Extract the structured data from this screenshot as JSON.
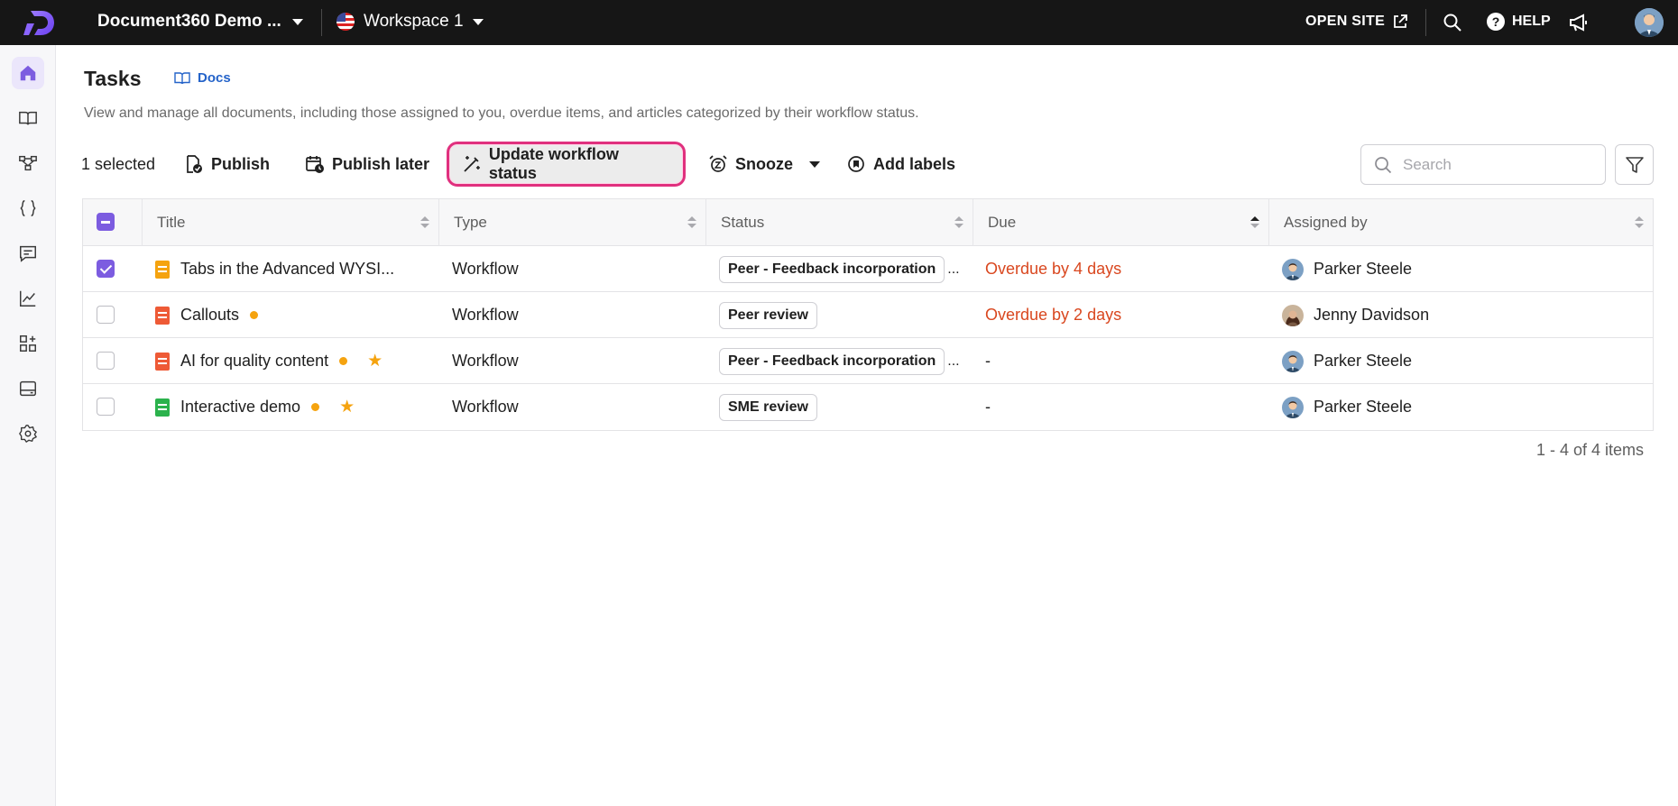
{
  "topbar": {
    "project_name": "Document360 Demo ...",
    "workspace": "Workspace 1",
    "open_site": "OPEN SITE",
    "help": "HELP",
    "help_glyph": "?"
  },
  "sidebar": {
    "items": [
      {
        "name": "home-icon",
        "active": true
      },
      {
        "name": "book-icon",
        "active": false
      },
      {
        "name": "workflow-icon",
        "active": false
      },
      {
        "name": "api-braces-icon",
        "active": false
      },
      {
        "name": "feedback-icon",
        "active": false
      },
      {
        "name": "analytics-icon",
        "active": false
      },
      {
        "name": "integrations-icon",
        "active": false
      },
      {
        "name": "widget-icon",
        "active": false
      },
      {
        "name": "settings-icon",
        "active": false
      }
    ]
  },
  "header": {
    "title": "Tasks",
    "docs_link": "Docs",
    "subtitle": "View and manage all documents, including those assigned to you, overdue items, and articles categorized by their workflow status."
  },
  "toolbar": {
    "selected_count": "1 selected",
    "publish": "Publish",
    "publish_later": "Publish later",
    "update_workflow": "Update workflow status",
    "snooze": "Snooze",
    "add_labels": "Add labels",
    "search_placeholder": "Search"
  },
  "table": {
    "headers": {
      "title": "Title",
      "type": "Type",
      "status": "Status",
      "due": "Due",
      "assigned_by": "Assigned by"
    },
    "rows": [
      {
        "title": "Tabs in the Advanced WYSI...",
        "doc_color": "#f5a30f",
        "dot": false,
        "star": false,
        "type": "Workflow",
        "status": "Peer - Feedback incorporation",
        "status_truncated": true,
        "due": "Overdue by 4 days",
        "overdue": true,
        "assigned_by": "Parker Steele",
        "checked": true
      },
      {
        "title": "Callouts",
        "doc_color": "#ee5a36",
        "dot": true,
        "star": false,
        "type": "Workflow",
        "status": "Peer review",
        "status_truncated": false,
        "due": "Overdue by 2 days",
        "overdue": true,
        "assigned_by": "Jenny Davidson",
        "checked": false
      },
      {
        "title": "AI for quality content",
        "doc_color": "#ee5a36",
        "dot": true,
        "star": true,
        "type": "Workflow",
        "status": "Peer - Feedback incorporation",
        "status_truncated": true,
        "due": "-",
        "overdue": false,
        "assigned_by": "Parker Steele",
        "checked": false
      },
      {
        "title": "Interactive demo",
        "doc_color": "#2bb24c",
        "dot": true,
        "star": true,
        "type": "Workflow",
        "status": "SME review",
        "status_truncated": false,
        "due": "-",
        "overdue": false,
        "assigned_by": "Parker Steele",
        "checked": false
      }
    ]
  },
  "pagination": "1 - 4 of 4 items",
  "colors": {
    "accent": "#7c5ce0",
    "highlight_border": "#e0307e",
    "overdue": "#d9471f",
    "link": "#2463c9"
  }
}
